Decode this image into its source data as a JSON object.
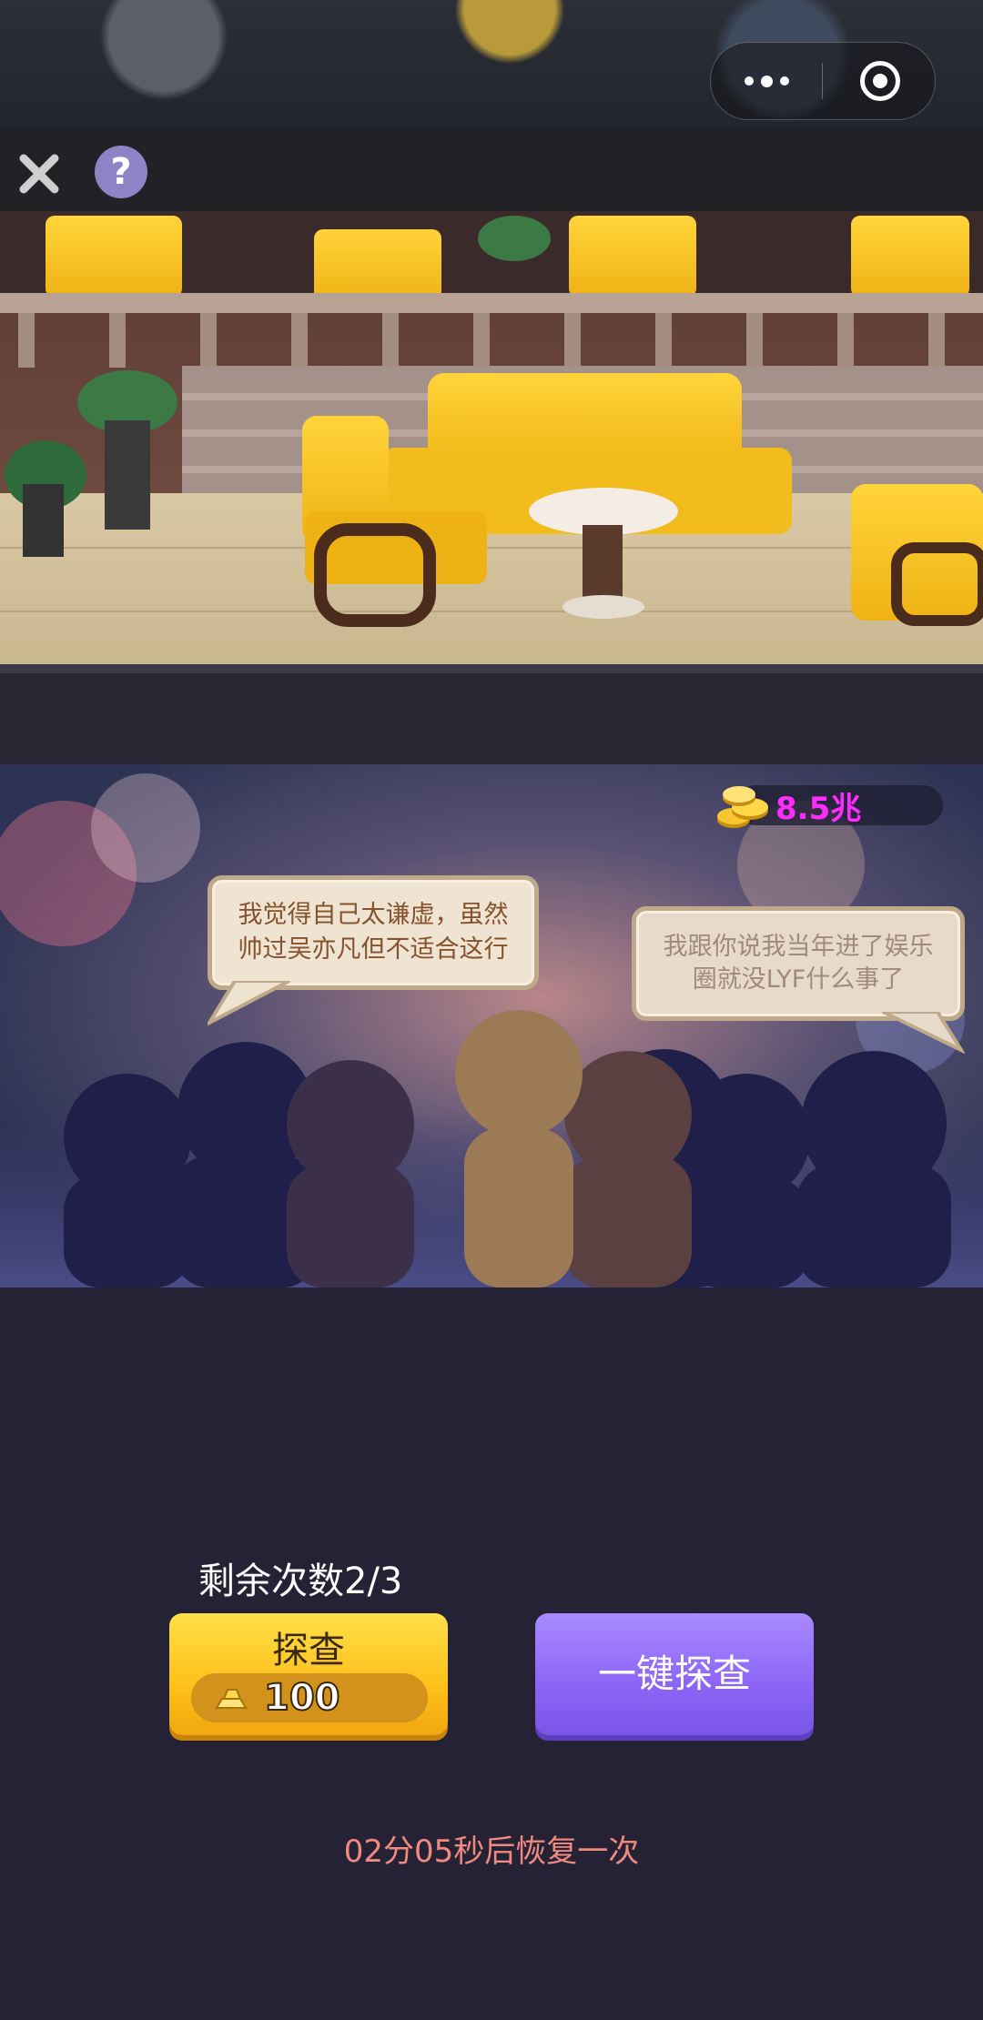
{
  "header": {
    "more_icon": "more-dots-icon",
    "record_icon": "target-icon",
    "close_icon": "close-icon",
    "help_label": "?"
  },
  "status": {
    "coins": "8.5兆",
    "coin_color": "#ff2cff"
  },
  "dialogue": {
    "left": "我觉得自己太谦虚，虽然帅过吴亦凡但不适合这行",
    "right": "我跟你说我当年进了娱乐圈就没LYF什么事了"
  },
  "actions": {
    "remaining": "剩余次数2/3",
    "probe_label": "探查",
    "probe_cost": "100",
    "oneclick_label": "一键探查",
    "recover_text": "02分05秒后恢复一次"
  },
  "colors": {
    "background": "#252236",
    "probe_yellow": "#fdc01a",
    "oneclick_purple": "#8c64f6",
    "recover_text": "#f08a7e"
  }
}
